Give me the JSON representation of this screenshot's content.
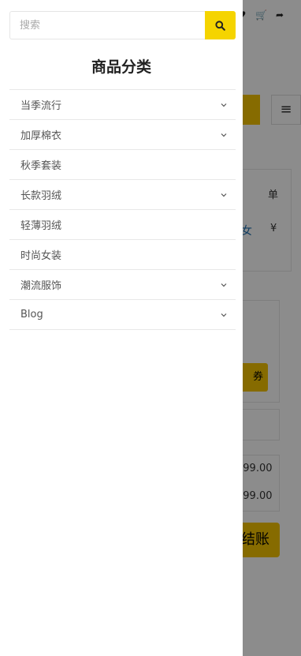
{
  "search": {
    "placeholder": "搜索",
    "value": ""
  },
  "drawer": {
    "title": "商品分类"
  },
  "categories": [
    {
      "label": "当季流行",
      "has_sub": true
    },
    {
      "label": "加厚棉衣",
      "has_sub": true
    },
    {
      "label": "秋季套装",
      "has_sub": false
    },
    {
      "label": "长款羽绒",
      "has_sub": true
    },
    {
      "label": "轻薄羽绒",
      "has_sub": false
    },
    {
      "label": "时尚女装",
      "has_sub": false
    },
    {
      "label": "潮流服饰",
      "has_sub": true
    },
    {
      "label": "Blog",
      "has_sub": true
    }
  ],
  "background": {
    "table_header": "单",
    "product_link": "女",
    "yen_symbol": "¥",
    "coupon_fragment": "券",
    "price_1": "¥99.00",
    "price_2": "¥99.00",
    "checkout_fragment": "结账"
  },
  "colors": {
    "accent": "#f5d400",
    "overlay": "rgba(0,0,0,0.45)"
  }
}
